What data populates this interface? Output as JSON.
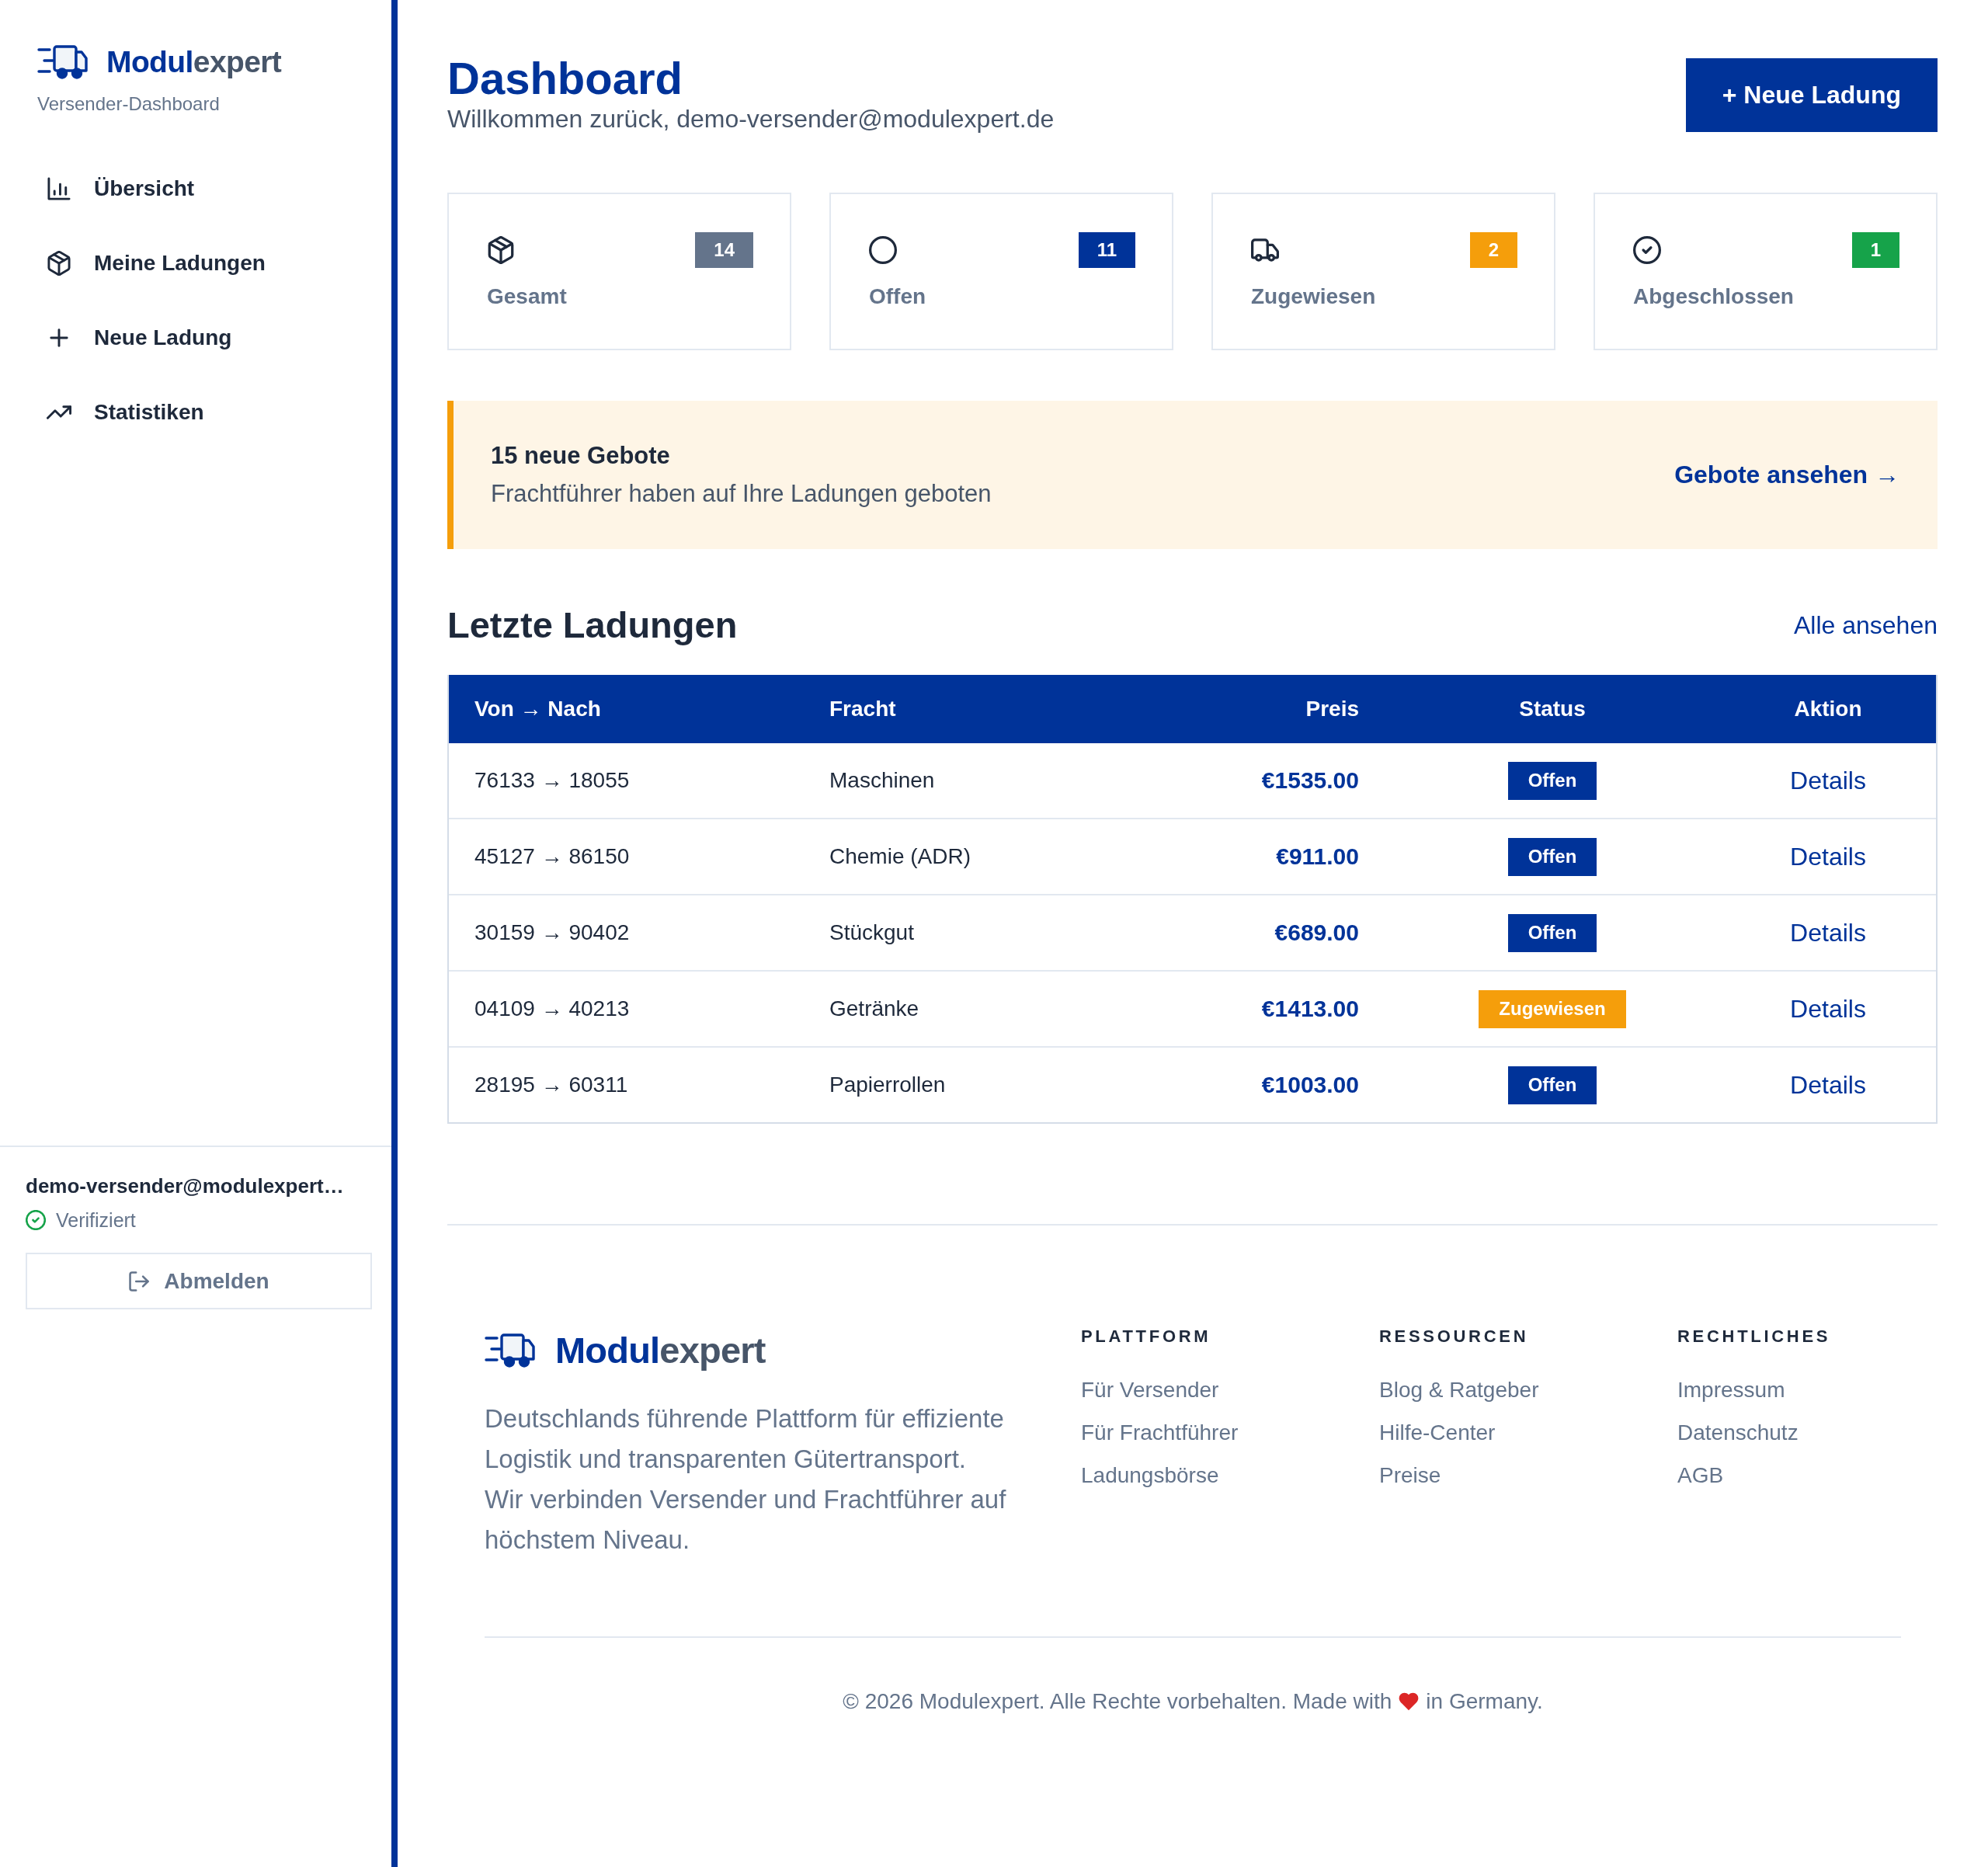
{
  "sidebar": {
    "brand": {
      "name_parts": [
        "Modul",
        "expert"
      ]
    },
    "subtitle": "Versender-Dashboard",
    "nav": [
      {
        "label": "Übersicht"
      },
      {
        "label": "Meine Ladungen"
      },
      {
        "label": "Neue Ladung"
      },
      {
        "label": "Statistiken"
      }
    ],
    "user": {
      "email": "demo-versender@modulexpert…",
      "verified": true,
      "verified_label": "Verifiziert"
    },
    "logout_button": "Abmelden"
  },
  "header": {
    "title": "Dashboard",
    "welcome": "Willkommen zurück, demo-versender@modulexpert.de",
    "new_load_button": "+ Neue Ladung"
  },
  "stats": [
    {
      "label": "Gesamt",
      "count": "14",
      "color": "#64748b"
    },
    {
      "label": "Offen",
      "count": "11",
      "color": "#003399"
    },
    {
      "label": "Zugewiesen",
      "count": "2",
      "color": "#f59e0b"
    },
    {
      "label": "Abgeschlossen",
      "count": "1",
      "color": "#16a34a"
    }
  ],
  "bids_banner": {
    "title": "15 neue Gebote",
    "text": "Frachtführer haben auf Ihre Ladungen geboten",
    "link": "Gebote ansehen →"
  },
  "recent_loads": {
    "title": "Letzte Ladungen",
    "link": "Alle ansehen",
    "table": {
      "columns": [
        "Von → Nach",
        "Fracht",
        "Preis",
        "Status",
        "Aktion"
      ],
      "rows": [
        {
          "route": "76133 → 18055",
          "cargo": "Maschinen",
          "price": "€1535.00",
          "status": {
            "label": "Offen",
            "color": "#003399"
          },
          "action": "Details"
        },
        {
          "route": "45127 → 86150",
          "cargo": "Chemie (ADR)",
          "price": "€911.00",
          "status": {
            "label": "Offen",
            "color": "#003399"
          },
          "action": "Details"
        },
        {
          "route": "30159 → 90402",
          "cargo": "Stückgut",
          "price": "€689.00",
          "status": {
            "label": "Offen",
            "color": "#003399"
          },
          "action": "Details"
        },
        {
          "route": "04109 → 40213",
          "cargo": "Getränke",
          "price": "€1413.00",
          "status": {
            "label": "Zugewiesen",
            "color": "#f59e0b"
          },
          "action": "Details"
        },
        {
          "route": "28195 → 60311",
          "cargo": "Papierrollen",
          "price": "€1003.00",
          "status": {
            "label": "Offen",
            "color": "#003399"
          },
          "action": "Details"
        }
      ]
    }
  },
  "footer": {
    "brand": {
      "name_parts": [
        "Modul",
        "expert"
      ]
    },
    "description": "Deutschlands führende Plattform für effiziente Logistik und transparenten Gütertransport. Wir verbinden Versender und Frachtführer auf höchstem Niveau.",
    "columns": [
      {
        "heading": "PLATTFORM",
        "links": [
          "Für Versender",
          "Für Frachtführer",
          "Ladungsbörse"
        ]
      },
      {
        "heading": "RESSOURCEN",
        "links": [
          "Blog & Ratgeber",
          "Hilfe-Center",
          "Preise"
        ]
      },
      {
        "heading": "RECHTLICHES",
        "links": [
          "Impressum",
          "Datenschutz",
          "AGB"
        ]
      }
    ],
    "copyright": "© 2026 Modulexpert. Alle Rechte vorbehalten. Made with",
    "copyright_suffix": "in Germany."
  }
}
